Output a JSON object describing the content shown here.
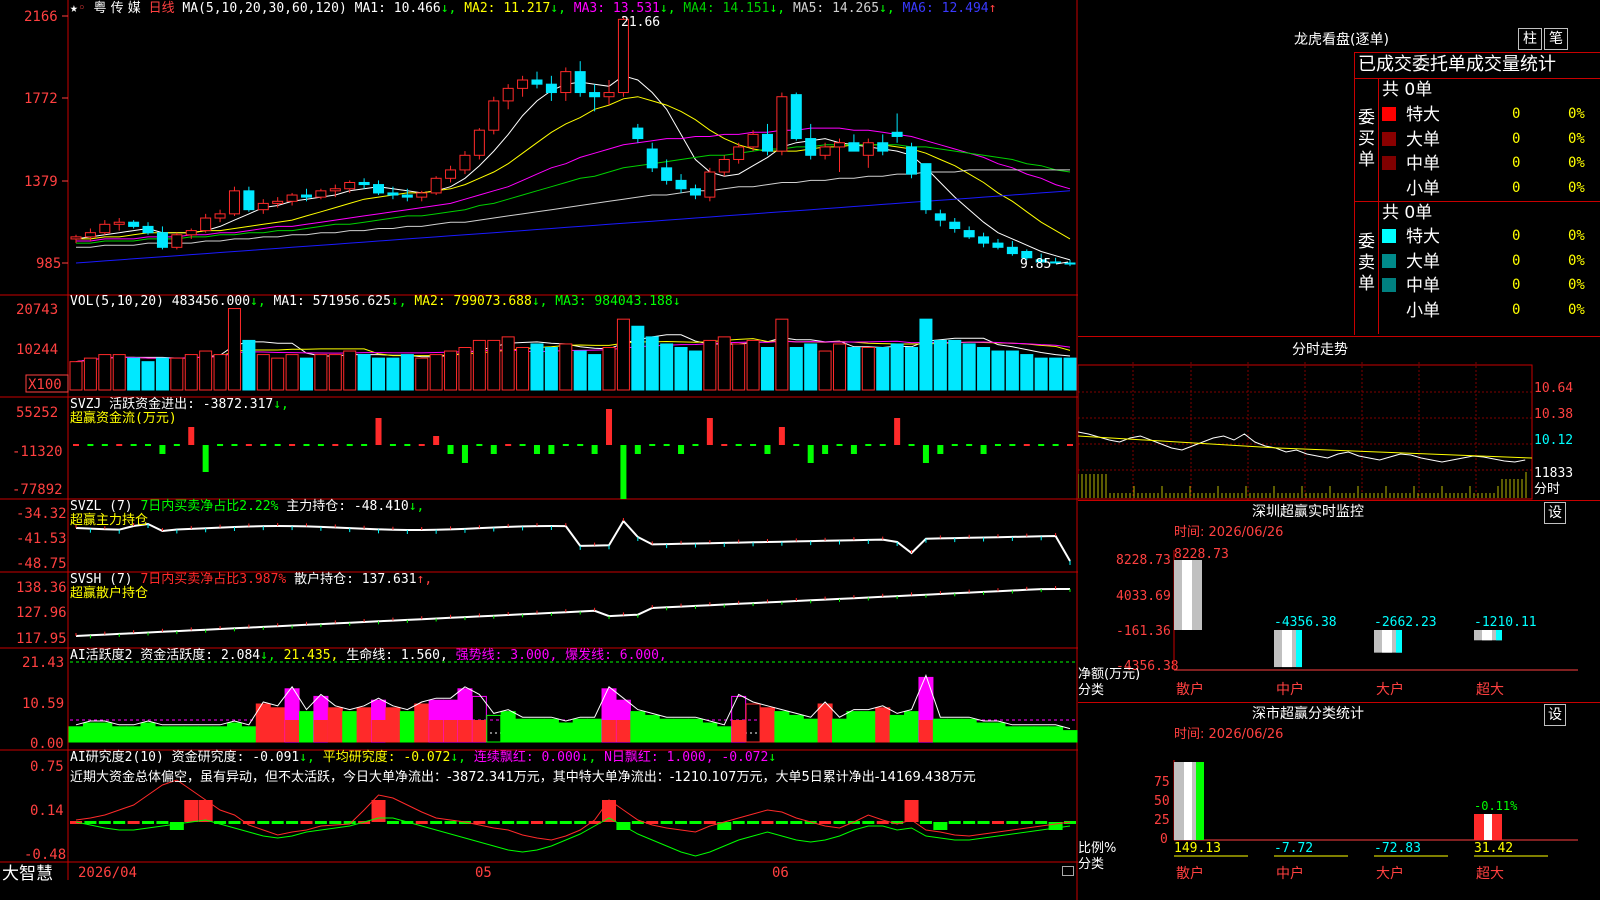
{
  "colors": {
    "up": "#ff2a2a",
    "down": "#00e8ff",
    "frame": "#c80000",
    "axis_text": "#ff4040",
    "ma1": "#ffffff",
    "ma2": "#ffff00",
    "ma3": "#ff00ff",
    "ma4": "#00d000",
    "ma5": "#d0d0d0",
    "ma6": "#1a1aff",
    "green": "#00ff00",
    "magenta": "#ff00ff",
    "yellow": "#ffff00",
    "white": "#ffffff",
    "cyan": "#00ffff"
  },
  "header": {
    "name": "粤 传 媒",
    "period": "日线",
    "ma_params": "MA(5,10,20,30,60,120)",
    "ma1": "MA1: 10.466",
    "ma2": "MA2: 11.217",
    "ma3": "MA3: 13.531",
    "ma4": "MA4: 14.151",
    "ma5": "MA5: 14.265",
    "ma6": "MA6: 12.494",
    "high_label": "21.66",
    "low_label": "9.85"
  },
  "volume_header": {
    "params": "VOL(5,10,20)",
    "vol": "483456.000",
    "ma1": "MA1: 571956.625",
    "ma2": "MA2: 799073.688",
    "ma3": "MA3: 984043.188"
  },
  "svzj_header": {
    "line1": "SVZJ  活跃资金进出: -3872.317",
    "line2": "超赢资金流(万元)"
  },
  "svzl_header": {
    "name": "SVZL (7)",
    "ratio": "7日内买卖净占比2.22%",
    "hold": "主力持仓: -48.410",
    "sub": "超赢主力持仓"
  },
  "svsh_header": {
    "name": "SVSH (7)",
    "ratio": "7日内买卖净占比3.987%",
    "hold": "散户持仓: 137.631",
    "sub": "超赢散户持仓"
  },
  "ai_header": {
    "a": "AI活跃度2 资金活跃度: 2.084",
    "b": "21.435,",
    "c": "生命线: 1.560,",
    "d": "强势线: 3.000,",
    "e": "爆发线: 6.000,"
  },
  "ai2_header": {
    "a": "AI研究度2(10) 资金研究度: -0.091",
    "b": "平均研究度: -0.072",
    "c": "连续飘红: 0.000",
    "d": "N日飘红: 1.000, -0.072"
  },
  "ai2_note": "近期大资金总体偏空，虽有异动，但不太活跃，今日大单净流出：-3872.341万元，其中特大单净流出：-1210.107万元，大单5日累计净出-14169.438万元",
  "bottom": {
    "brand": "大智慧",
    "date": "2026/04",
    "m05": "05",
    "m06": "06"
  },
  "right": {
    "dragon_title": "龙虎看盘(逐单)",
    "btn1": "柱",
    "btn2": "笔",
    "tabs_label": "已成交委托单成交量统计",
    "buy_vert": "委买单",
    "sell_vert": "委卖单",
    "buy_total": "共 0单",
    "sell_total": "共 0单",
    "buy_rows": [
      {
        "name": "特大",
        "val": "0",
        "pct": "0%",
        "color": "#ff0000"
      },
      {
        "name": "大单",
        "val": "0",
        "pct": "0%",
        "color": "#8b0000"
      },
      {
        "name": "中单",
        "val": "0",
        "pct": "0%",
        "color": "#800000"
      },
      {
        "name": "小单",
        "val": "0",
        "pct": "0%",
        "color": ""
      }
    ],
    "sell_rows": [
      {
        "name": "特大",
        "val": "0",
        "pct": "0%",
        "color": "#00ffff"
      },
      {
        "name": "大单",
        "val": "0",
        "pct": "0%",
        "color": "#008b8b"
      },
      {
        "name": "中单",
        "val": "0",
        "pct": "0%",
        "color": "#008080"
      },
      {
        "name": "小单",
        "val": "0",
        "pct": "0%",
        "color": ""
      }
    ],
    "intraday_title": "分时走势",
    "intraday_prices": [
      "10.64",
      "10.38",
      "10.12"
    ],
    "intraday_vol": "11833",
    "intraday_vol_label": "分时",
    "monitor_title": "深圳超赢实时监控",
    "monitor_setbtn": "设",
    "monitor_time": "时间: 2026/06/26",
    "monitor_axis": [
      "8228.73",
      "4033.69",
      "-161.36",
      "-4356.38"
    ],
    "monitor_ylabel": "净额(万元)",
    "monitor_xlabel": "分类",
    "classify_title": "深市超赢分类统计",
    "classify_setbtn": "设",
    "classify_time": "时间: 2026/06/26",
    "classify_axis": [
      "75",
      "50",
      "25",
      "0"
    ],
    "classify_ylabel": "比例%",
    "classify_xlabel": "分类"
  },
  "chart_data": [
    {
      "type": "candlestick",
      "title": "粤传媒 日线",
      "y_ticks": [
        "2166",
        "1772",
        "1379",
        "985"
      ],
      "ylim": [
        9.0,
        22.0
      ],
      "ohlc": [
        [
          11.0,
          11.2,
          10.8,
          11.1
        ],
        [
          11.1,
          11.5,
          10.9,
          11.3
        ],
        [
          11.3,
          11.9,
          11.2,
          11.7
        ],
        [
          11.7,
          12.0,
          11.4,
          11.8
        ],
        [
          11.8,
          11.9,
          11.5,
          11.6
        ],
        [
          11.6,
          11.8,
          11.2,
          11.3
        ],
        [
          11.3,
          11.6,
          10.5,
          10.6
        ],
        [
          10.6,
          11.3,
          10.5,
          11.2
        ],
        [
          11.2,
          11.5,
          11.0,
          11.4
        ],
        [
          11.4,
          12.2,
          11.3,
          12.0
        ],
        [
          12.0,
          12.4,
          11.8,
          12.2
        ],
        [
          12.2,
          13.5,
          12.1,
          13.3
        ],
        [
          13.3,
          13.5,
          12.3,
          12.4
        ],
        [
          12.4,
          12.9,
          12.2,
          12.7
        ],
        [
          12.7,
          13.0,
          12.5,
          12.8
        ],
        [
          12.8,
          13.2,
          12.6,
          13.1
        ],
        [
          13.1,
          13.4,
          12.8,
          13.0
        ],
        [
          13.0,
          13.4,
          12.9,
          13.3
        ],
        [
          13.3,
          13.6,
          13.0,
          13.4
        ],
        [
          13.4,
          13.8,
          13.2,
          13.7
        ],
        [
          13.7,
          13.9,
          13.4,
          13.6
        ],
        [
          13.6,
          13.8,
          13.1,
          13.2
        ],
        [
          13.2,
          13.5,
          12.9,
          13.1
        ],
        [
          13.1,
          13.4,
          12.8,
          13.0
        ],
        [
          13.0,
          13.3,
          12.8,
          13.2
        ],
        [
          13.2,
          14.0,
          13.1,
          13.9
        ],
        [
          13.9,
          14.5,
          13.7,
          14.3
        ],
        [
          14.3,
          15.2,
          14.1,
          15.0
        ],
        [
          15.0,
          16.3,
          14.8,
          16.2
        ],
        [
          16.2,
          17.8,
          16.0,
          17.6
        ],
        [
          17.6,
          18.4,
          17.2,
          18.2
        ],
        [
          18.2,
          18.8,
          17.8,
          18.6
        ],
        [
          18.6,
          19.0,
          18.2,
          18.4
        ],
        [
          18.4,
          18.8,
          17.6,
          18.0
        ],
        [
          18.0,
          19.2,
          17.6,
          19.0
        ],
        [
          19.0,
          19.5,
          17.8,
          18.0
        ],
        [
          18.0,
          18.4,
          17.1,
          17.8
        ],
        [
          17.8,
          18.6,
          17.4,
          18.0
        ],
        [
          18.0,
          21.66,
          17.8,
          21.5
        ],
        [
          16.3,
          16.5,
          15.6,
          15.8
        ],
        [
          15.3,
          15.6,
          14.2,
          14.4
        ],
        [
          14.4,
          14.8,
          13.6,
          13.8
        ],
        [
          13.8,
          14.1,
          13.2,
          13.4
        ],
        [
          13.4,
          13.6,
          12.9,
          13.1
        ],
        [
          13.0,
          14.4,
          12.8,
          14.2
        ],
        [
          14.2,
          15.0,
          14.0,
          14.8
        ],
        [
          14.8,
          15.6,
          14.6,
          15.4
        ],
        [
          15.4,
          16.2,
          15.2,
          16.0
        ],
        [
          16.0,
          16.5,
          15.0,
          15.2
        ],
        [
          15.2,
          18.0,
          15.0,
          17.8
        ],
        [
          17.9,
          18.0,
          15.7,
          15.8
        ],
        [
          15.8,
          16.5,
          14.8,
          15.0
        ],
        [
          15.0,
          15.6,
          14.8,
          15.4
        ],
        [
          15.4,
          15.8,
          14.2,
          15.6
        ],
        [
          15.6,
          16.0,
          15.2,
          15.2
        ],
        [
          15.0,
          15.8,
          14.4,
          15.6
        ],
        [
          15.6,
          16.0,
          15.0,
          15.2
        ],
        [
          16.1,
          17.0,
          15.6,
          15.9
        ],
        [
          15.4,
          15.6,
          13.9,
          14.1
        ],
        [
          14.6,
          14.6,
          12.2,
          12.4
        ],
        [
          12.2,
          12.4,
          11.6,
          11.9
        ],
        [
          11.8,
          12.0,
          11.3,
          11.5
        ],
        [
          11.4,
          11.6,
          11.0,
          11.1
        ],
        [
          11.1,
          11.3,
          10.6,
          10.8
        ],
        [
          10.8,
          11.0,
          10.5,
          10.6
        ],
        [
          10.6,
          10.9,
          10.2,
          10.3
        ],
        [
          10.4,
          10.5,
          10.0,
          10.1
        ],
        [
          10.0,
          10.3,
          9.85,
          9.9
        ],
        [
          9.9,
          10.1,
          9.85,
          9.85
        ],
        [
          9.85,
          10.0,
          9.7,
          9.8
        ]
      ],
      "series": [
        {
          "name": "MA1",
          "color": "#ffffff",
          "values": [
            11.0,
            11.1,
            11.2,
            11.3,
            11.4,
            11.5,
            11.3,
            11.3,
            11.3,
            11.4,
            11.6,
            11.9,
            12.2,
            12.5,
            12.6,
            12.8,
            12.9,
            13.0,
            13.1,
            13.3,
            13.4,
            13.5,
            13.4,
            13.3,
            13.2,
            13.3,
            13.5,
            13.9,
            14.5,
            15.2,
            16.0,
            16.9,
            17.6,
            18.1,
            18.4,
            18.5,
            18.4,
            18.3,
            18.8,
            18.6,
            18.0,
            17.2,
            16.0,
            14.8,
            14.2,
            14.0,
            14.1,
            14.5,
            14.9,
            15.4,
            15.6,
            15.7,
            15.8,
            15.6,
            15.5,
            15.4,
            15.3,
            15.2,
            15.0,
            14.4,
            13.7,
            13.0,
            12.4,
            11.8,
            11.3,
            11.0,
            10.7,
            10.4,
            10.2,
            10.0
          ]
        },
        {
          "name": "MA2",
          "color": "#ffff00",
          "values": [
            11.0,
            11.0,
            11.1,
            11.1,
            11.2,
            11.3,
            11.3,
            11.3,
            11.3,
            11.4,
            11.4,
            11.5,
            11.6,
            11.7,
            11.8,
            11.9,
            12.1,
            12.3,
            12.5,
            12.7,
            12.9,
            13.0,
            13.1,
            13.2,
            13.2,
            13.3,
            13.4,
            13.6,
            13.9,
            14.2,
            14.6,
            15.1,
            15.6,
            16.1,
            16.5,
            16.8,
            17.2,
            17.4,
            17.7,
            17.8,
            17.6,
            17.4,
            17.1,
            16.7,
            16.2,
            15.8,
            15.5,
            15.3,
            15.2,
            15.2,
            15.2,
            15.3,
            15.4,
            15.4,
            15.5,
            15.5,
            15.5,
            15.4,
            15.3,
            15.1,
            14.8,
            14.5,
            14.1,
            13.7,
            13.2,
            12.8,
            12.3,
            11.8,
            11.4,
            11.0
          ]
        },
        {
          "name": "MA3",
          "color": "#ff00ff",
          "values": [
            10.9,
            10.9,
            11.0,
            11.0,
            11.0,
            11.1,
            11.1,
            11.1,
            11.2,
            11.2,
            11.3,
            11.3,
            11.4,
            11.5,
            11.6,
            11.6,
            11.7,
            11.8,
            11.9,
            12.0,
            12.1,
            12.2,
            12.3,
            12.4,
            12.5,
            12.6,
            12.7,
            12.9,
            13.1,
            13.3,
            13.5,
            13.8,
            14.1,
            14.4,
            14.6,
            14.9,
            15.1,
            15.3,
            15.5,
            15.6,
            15.7,
            15.8,
            15.8,
            15.9,
            15.9,
            16.0,
            16.0,
            16.1,
            16.1,
            16.2,
            16.2,
            16.3,
            16.3,
            16.3,
            16.2,
            16.2,
            16.1,
            16.0,
            15.9,
            15.7,
            15.5,
            15.3,
            15.1,
            14.9,
            14.6,
            14.4,
            14.1,
            13.9,
            13.6,
            13.4
          ]
        },
        {
          "name": "MA4",
          "color": "#00d000",
          "values": [
            10.8,
            10.8,
            10.9,
            10.9,
            10.9,
            11.0,
            11.0,
            11.0,
            11.1,
            11.1,
            11.2,
            11.2,
            11.3,
            11.3,
            11.4,
            11.4,
            11.5,
            11.6,
            11.7,
            11.7,
            11.8,
            11.9,
            12.0,
            12.1,
            12.1,
            12.2,
            12.3,
            12.4,
            12.6,
            12.7,
            12.9,
            13.1,
            13.3,
            13.5,
            13.7,
            13.9,
            14.0,
            14.2,
            14.4,
            14.5,
            14.6,
            14.7,
            14.8,
            14.9,
            15.0,
            15.0,
            15.1,
            15.2,
            15.3,
            15.3,
            15.4,
            15.4,
            15.5,
            15.5,
            15.5,
            15.5,
            15.5,
            15.5,
            15.4,
            15.4,
            15.3,
            15.2,
            15.1,
            15.0,
            14.9,
            14.8,
            14.6,
            14.5,
            14.3,
            14.2
          ]
        },
        {
          "name": "MA5",
          "color": "#d0d0d0",
          "values": [
            10.6,
            10.6,
            10.7,
            10.7,
            10.7,
            10.8,
            10.8,
            10.8,
            10.8,
            10.9,
            10.9,
            11.0,
            11.0,
            11.1,
            11.1,
            11.2,
            11.2,
            11.3,
            11.3,
            11.4,
            11.4,
            11.5,
            11.5,
            11.6,
            11.6,
            11.7,
            11.8,
            11.8,
            11.9,
            12.0,
            12.1,
            12.2,
            12.3,
            12.4,
            12.5,
            12.6,
            12.7,
            12.8,
            12.9,
            13.0,
            13.1,
            13.1,
            13.2,
            13.3,
            13.3,
            13.4,
            13.5,
            13.5,
            13.6,
            13.7,
            13.7,
            13.8,
            13.8,
            13.9,
            13.9,
            14.0,
            14.0,
            14.1,
            14.1,
            14.2,
            14.2,
            14.2,
            14.3,
            14.3,
            14.3,
            14.3,
            14.3,
            14.3,
            14.3,
            14.3
          ]
        },
        {
          "name": "MA6",
          "color": "#1a1aff",
          "values": [
            9.85,
            9.9,
            9.95,
            10.0,
            10.05,
            10.1,
            10.15,
            10.2,
            10.25,
            10.3,
            10.35,
            10.4,
            10.45,
            10.5,
            10.55,
            10.6,
            10.65,
            10.7,
            10.75,
            10.8,
            10.85,
            10.9,
            10.95,
            11.0,
            11.05,
            11.1,
            11.15,
            11.2,
            11.25,
            11.3,
            11.35,
            11.4,
            11.45,
            11.5,
            11.55,
            11.6,
            11.65,
            11.7,
            11.75,
            11.8,
            11.85,
            11.9,
            11.95,
            12.0,
            12.05,
            12.1,
            12.15,
            12.2,
            12.25,
            12.3,
            12.35,
            12.4,
            12.45,
            12.5,
            12.55,
            12.6,
            12.65,
            12.7,
            12.75,
            12.8,
            12.85,
            12.9,
            12.95,
            13.0,
            13.05,
            13.1,
            13.15,
            13.2,
            13.25,
            13.3
          ]
        }
      ]
    },
    {
      "type": "bar",
      "title": "VOL",
      "y_ticks": [
        "20743",
        "10244",
        "X100"
      ],
      "values": [
        8,
        9,
        10,
        10,
        9,
        8,
        9,
        9,
        10,
        11,
        10,
        23,
        14,
        10,
        9,
        10,
        9,
        10,
        10,
        11,
        10,
        9,
        9,
        10,
        9,
        10,
        11,
        12,
        14,
        14,
        15,
        12,
        13,
        12,
        13,
        11,
        10,
        12,
        20,
        18,
        15,
        13,
        12,
        11,
        14,
        15,
        13,
        14,
        12,
        20,
        12,
        13,
        11,
        13,
        12,
        12,
        12,
        13,
        12,
        20,
        14,
        14,
        13,
        12,
        11,
        11,
        10,
        9,
        9,
        9
      ],
      "ylim": [
        0,
        24
      ]
    },
    {
      "type": "bar",
      "title": "SVZJ 超赢资金流",
      "y_ticks": [
        "55252",
        "-11320",
        "-77892"
      ],
      "values": [
        0,
        0,
        0,
        0,
        0,
        0,
        -1,
        0,
        2,
        -3,
        0,
        0,
        0,
        0,
        0,
        0,
        0,
        0,
        0,
        0,
        0,
        3,
        0,
        0,
        0,
        1,
        -1,
        -2,
        0,
        -1,
        0,
        0,
        -1,
        -1,
        0,
        0,
        -1,
        4,
        -6,
        -1,
        0,
        0,
        -1,
        0,
        3,
        0,
        0,
        0,
        -1,
        2,
        0,
        -2,
        -1,
        0,
        -1,
        0,
        0,
        3,
        0,
        -2,
        -1,
        0,
        0,
        -1,
        0,
        0,
        0,
        0,
        0,
        0
      ],
      "ylim": [
        -8,
        5
      ]
    }
  ]
}
